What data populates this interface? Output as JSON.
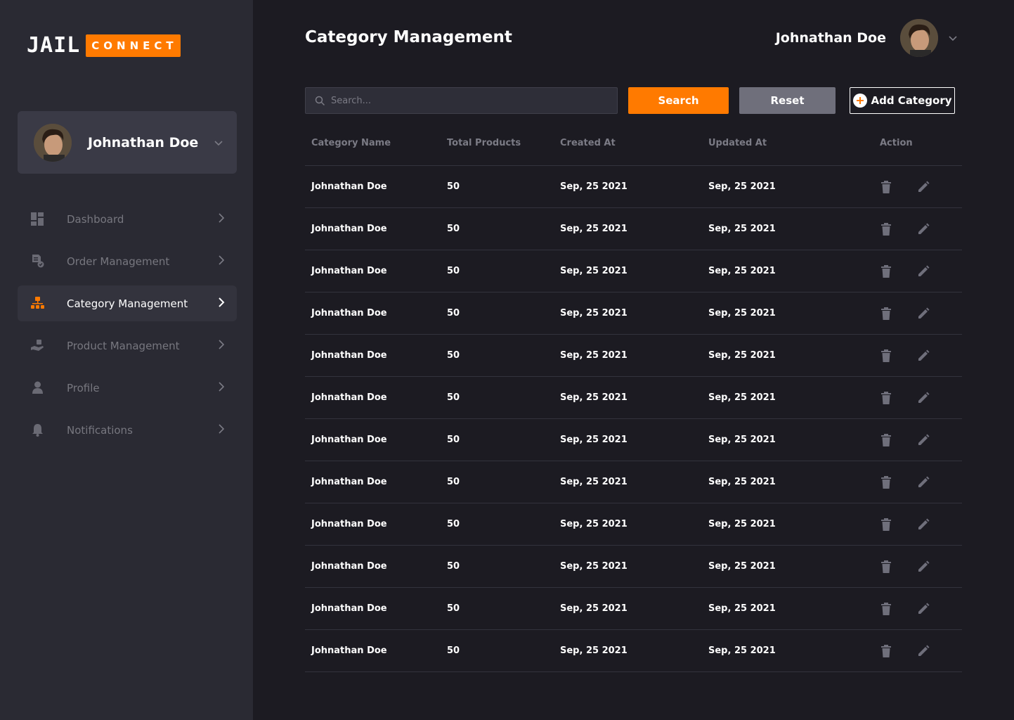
{
  "brand": {
    "logo_left": "JAIL",
    "logo_right": "CONNECT"
  },
  "colors": {
    "accent": "#ff7a00",
    "sidebar_bg": "#2a2a33",
    "page_bg": "#1c1b22",
    "reset_button": "#6f6f7b"
  },
  "sidebar": {
    "profile": {
      "name": "Johnathan Doe"
    },
    "items": [
      {
        "label": "Dashboard",
        "icon": "dashboard-icon",
        "active": false
      },
      {
        "label": "Order Management",
        "icon": "order-icon",
        "active": false
      },
      {
        "label": "Category Management",
        "icon": "category-icon",
        "active": true
      },
      {
        "label": "Product Management",
        "icon": "product-icon",
        "active": false
      },
      {
        "label": "Profile",
        "icon": "user-icon",
        "active": false
      },
      {
        "label": "Notifications",
        "icon": "bell-icon",
        "active": false
      }
    ]
  },
  "header": {
    "title": "Category Management",
    "user_name": "Johnathan Doe"
  },
  "toolbar": {
    "search_placeholder": "Search...",
    "search_label": "Search",
    "reset_label": "Reset",
    "add_label": "Add Category"
  },
  "table": {
    "columns": [
      "Category Name",
      "Total Products",
      "Created At",
      "Updated At",
      "Action"
    ],
    "rows": [
      {
        "name": "Johnathan Doe",
        "total": "50",
        "created": "Sep, 25 2021",
        "updated": "Sep, 25 2021"
      },
      {
        "name": "Johnathan Doe",
        "total": "50",
        "created": "Sep, 25 2021",
        "updated": "Sep, 25 2021"
      },
      {
        "name": "Johnathan Doe",
        "total": "50",
        "created": "Sep, 25 2021",
        "updated": "Sep, 25 2021"
      },
      {
        "name": "Johnathan Doe",
        "total": "50",
        "created": "Sep, 25 2021",
        "updated": "Sep, 25 2021"
      },
      {
        "name": "Johnathan Doe",
        "total": "50",
        "created": "Sep, 25 2021",
        "updated": "Sep, 25 2021"
      },
      {
        "name": "Johnathan Doe",
        "total": "50",
        "created": "Sep, 25 2021",
        "updated": "Sep, 25 2021"
      },
      {
        "name": "Johnathan Doe",
        "total": "50",
        "created": "Sep, 25 2021",
        "updated": "Sep, 25 2021"
      },
      {
        "name": "Johnathan Doe",
        "total": "50",
        "created": "Sep, 25 2021",
        "updated": "Sep, 25 2021"
      },
      {
        "name": "Johnathan Doe",
        "total": "50",
        "created": "Sep, 25 2021",
        "updated": "Sep, 25 2021"
      },
      {
        "name": "Johnathan Doe",
        "total": "50",
        "created": "Sep, 25 2021",
        "updated": "Sep, 25 2021"
      },
      {
        "name": "Johnathan Doe",
        "total": "50",
        "created": "Sep, 25 2021",
        "updated": "Sep, 25 2021"
      },
      {
        "name": "Johnathan Doe",
        "total": "50",
        "created": "Sep, 25 2021",
        "updated": "Sep, 25 2021"
      }
    ]
  }
}
